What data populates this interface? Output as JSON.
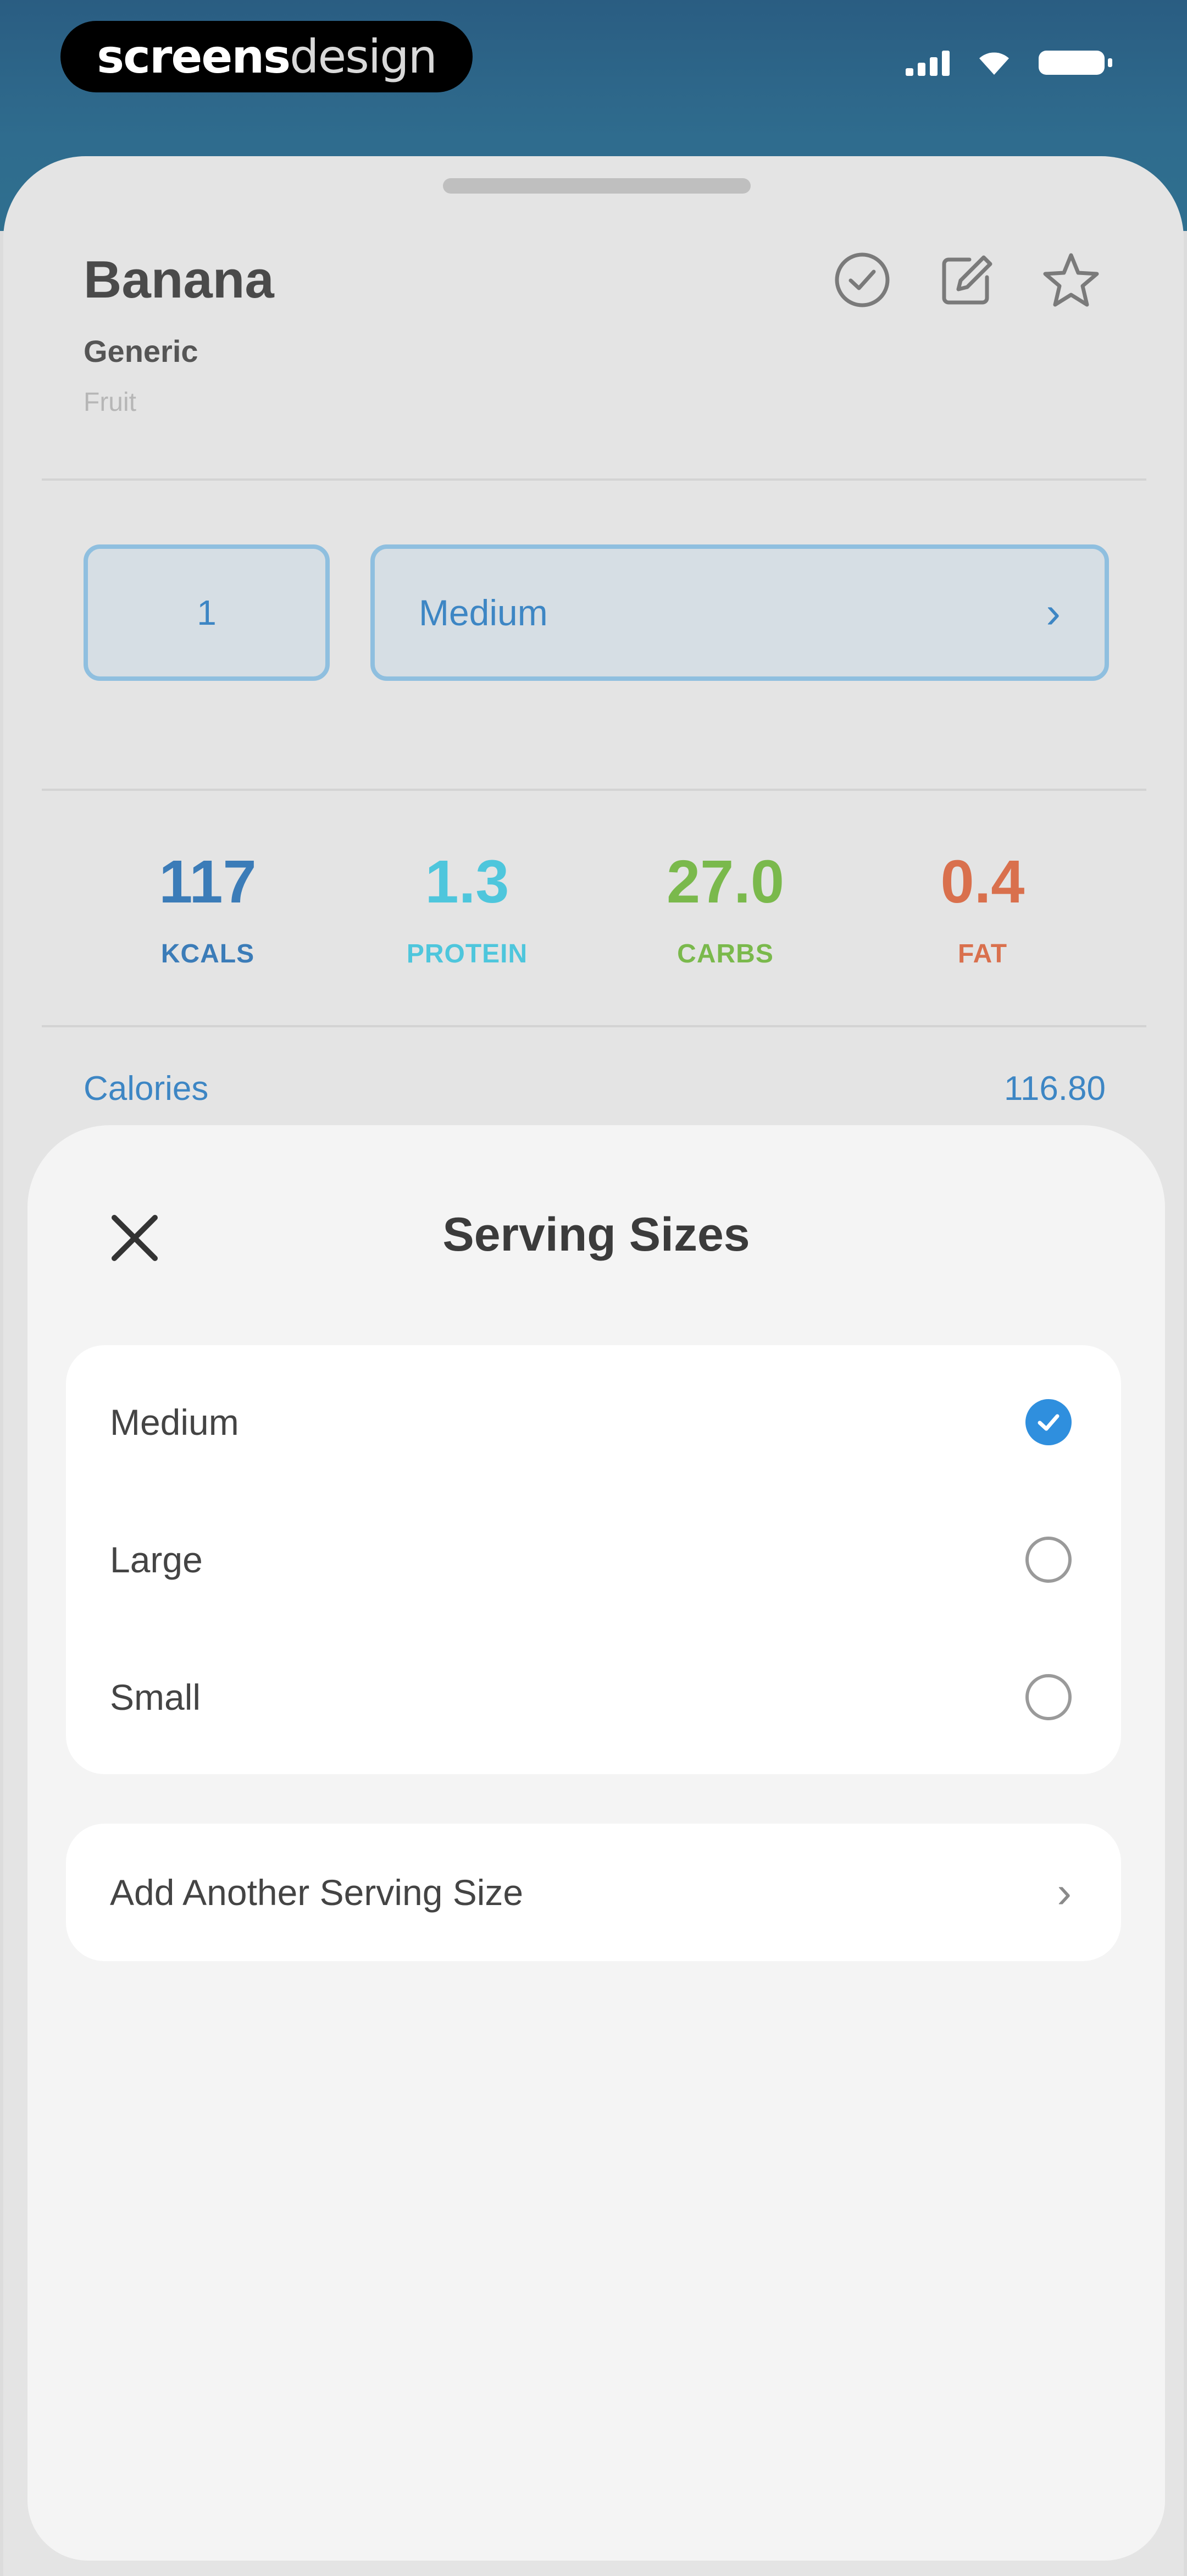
{
  "brand": {
    "bold": "screens",
    "light": "design"
  },
  "status_icons": [
    "signal-icon",
    "wifi-icon",
    "battery-icon"
  ],
  "food": {
    "name": "Banana",
    "brand": "Generic",
    "category": "Fruit",
    "actions": [
      "check-circle-icon",
      "edit-icon",
      "star-icon"
    ]
  },
  "serving": {
    "quantity": "1",
    "size": "Medium"
  },
  "macros": [
    {
      "value": "117",
      "label": "KCALS",
      "color": "#3b7cb8"
    },
    {
      "value": "1.3",
      "label": "PROTEIN",
      "color": "#4ec6dc"
    },
    {
      "value": "27.0",
      "label": "CARBS",
      "color": "#7ab94c"
    },
    {
      "value": "0.4",
      "label": "FAT",
      "color": "#d9704d"
    }
  ],
  "nutrition": {
    "calories_label": "Calories",
    "calories_value": "116.80"
  },
  "sheet": {
    "title": "Serving Sizes",
    "options": [
      {
        "label": "Medium",
        "selected": true
      },
      {
        "label": "Large",
        "selected": false
      },
      {
        "label": "Small",
        "selected": false
      }
    ],
    "add_label": "Add Another Serving Size"
  },
  "colors": {
    "accent": "#2f8fde",
    "header": "#2f6c8e"
  }
}
